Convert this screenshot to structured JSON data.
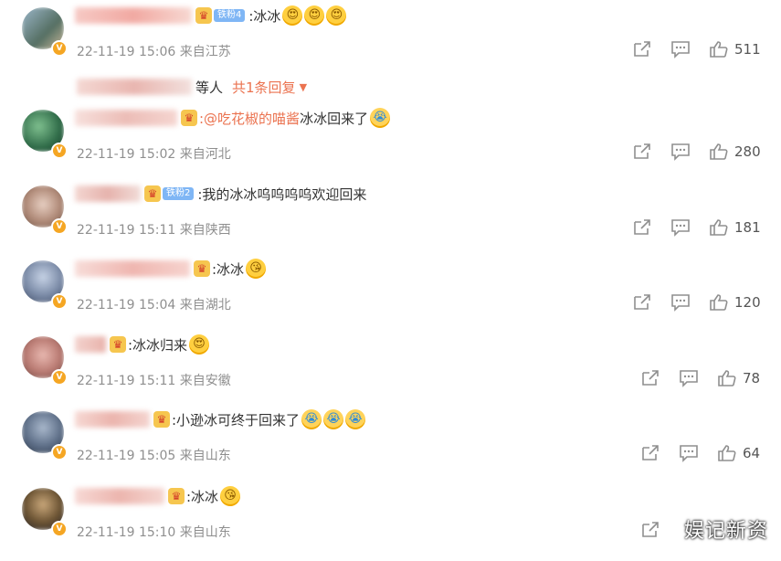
{
  "comments": [
    {
      "verified": "V",
      "fan_badge": "铁粉4",
      "text": ":冰冰",
      "emojis": [
        "heart",
        "heart",
        "heart"
      ],
      "time": "22-11-19 15:06",
      "location": "来自江苏",
      "likes": "511",
      "reply_suffix": "等人",
      "reply_count": "共1条回复",
      "reply_caret": "▼"
    },
    {
      "verified": "V",
      "mention": ":@吃花椒的喵酱",
      "text": " 冰冰回来了",
      "emojis": [
        "cry"
      ],
      "time": "22-11-19 15:02",
      "location": "来自河北",
      "likes": "280"
    },
    {
      "verified": "V",
      "fan_badge": "铁粉2",
      "text": ":我的冰冰呜呜呜呜欢迎回来",
      "time": "22-11-19 15:11",
      "location": "来自陕西",
      "likes": "181"
    },
    {
      "verified": "V",
      "text": ":冰冰",
      "emojis": [
        "love"
      ],
      "time": "22-11-19 15:04",
      "location": "来自湖北",
      "likes": "120"
    },
    {
      "verified": "V",
      "text": ":冰冰归来",
      "emojis": [
        "heart"
      ],
      "time": "22-11-19 15:11",
      "location": "来自安徽",
      "likes": "78"
    },
    {
      "verified": "V",
      "text": ":小逊冰可终于回来了",
      "emojis": [
        "cry",
        "cry",
        "cry"
      ],
      "time": "22-11-19 15:05",
      "location": "来自山东",
      "likes": "64"
    },
    {
      "verified": "V",
      "text": ":冰冰",
      "emojis": [
        "love"
      ],
      "time": "22-11-19 15:10",
      "location": "来自山东",
      "likes": ""
    }
  ],
  "watermark": "娱记新资",
  "icons": {
    "share": "share-icon",
    "comment": "comment-icon",
    "like": "thumbs-up-icon",
    "crown": "crown-icon"
  },
  "colors": {
    "link": "#eb7350",
    "meta": "#8f8f8f",
    "verified": "#f5a623",
    "fan_badge": "#7fb6f5"
  }
}
